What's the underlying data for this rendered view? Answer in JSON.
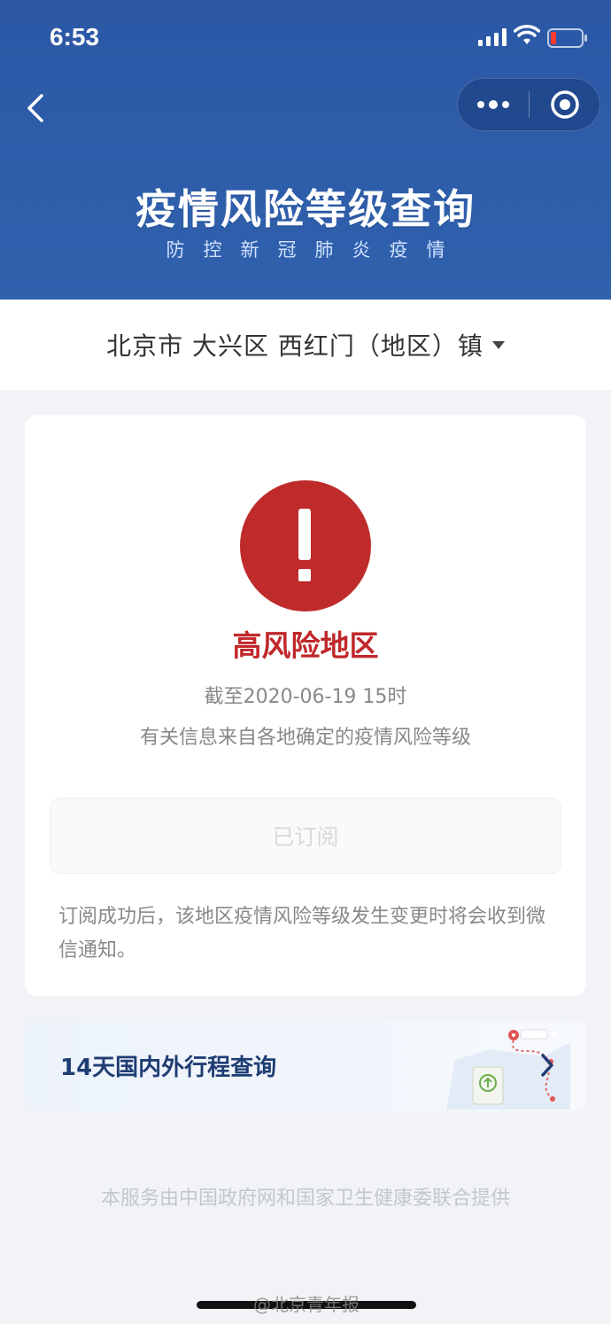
{
  "status_bar": {
    "time": "6:53"
  },
  "header": {
    "title": "疫情风险等级查询",
    "subtitle": "防控新冠肺炎疫情"
  },
  "region": {
    "selected": "北京市 大兴区 西红门（地区）镇"
  },
  "risk_card": {
    "level": "高风险地区",
    "date": "截至2020-06-19 15时",
    "source": "有关信息来自各地确定的疫情风险等级",
    "subscribe_label": "已订阅",
    "note": "订阅成功后，该地区疫情风险等级发生变更时将会收到微信通知。"
  },
  "itinerary": {
    "label": "14天国内外行程查询"
  },
  "footer": {
    "note": "本服务由中国政府网和国家卫生健康委联合提供"
  },
  "watermark": "@北京青年报",
  "colors": {
    "header_blue": "#2d5aa8",
    "alert_red": "#bf2a2a",
    "risk_text_red": "#c0282b",
    "itinerary_text": "#1f3d73"
  },
  "icons": [
    "signal-icon",
    "wifi-icon",
    "battery-icon",
    "back-arrow-icon",
    "more-dots-icon",
    "target-close-icon",
    "exclamation-icon",
    "chevron-right-icon",
    "map-route-illustration"
  ]
}
